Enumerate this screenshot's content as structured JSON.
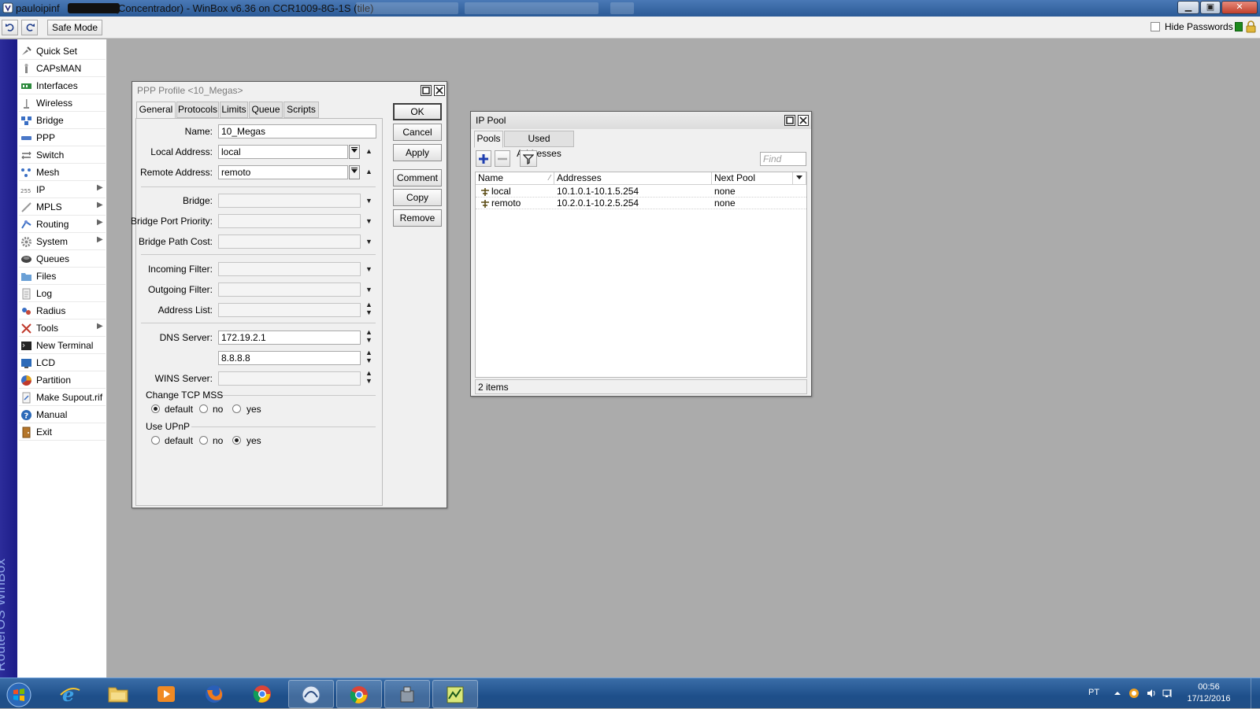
{
  "window": {
    "title_user": "pauloipinf",
    "title_rest": "(Concentrador) - WinBox v6.36 on CCR1009-8G-1S (tile)",
    "controls": {
      "minimize": "▁",
      "maximize": "▣",
      "close": "✕"
    }
  },
  "toolbar": {
    "undo_icon": "undo-icon",
    "redo_icon": "redo-icon",
    "safe_mode_label": "Safe Mode",
    "hide_passwords_label": "Hide Passwords",
    "hide_passwords_checked": false,
    "status_color": "#1d8a1d"
  },
  "branding": {
    "vertical_text": "RouterOS WinBox"
  },
  "sidebar": {
    "items": [
      {
        "label": "Quick Set",
        "icon": "quickset-icon",
        "submenu": false
      },
      {
        "label": "CAPsMAN",
        "icon": "capsman-icon",
        "submenu": false
      },
      {
        "label": "Interfaces",
        "icon": "interfaces-icon",
        "submenu": false
      },
      {
        "label": "Wireless",
        "icon": "wireless-icon",
        "submenu": false
      },
      {
        "label": "Bridge",
        "icon": "bridge-icon",
        "submenu": false
      },
      {
        "label": "PPP",
        "icon": "ppp-icon",
        "submenu": false
      },
      {
        "label": "Switch",
        "icon": "switch-icon",
        "submenu": false
      },
      {
        "label": "Mesh",
        "icon": "mesh-icon",
        "submenu": false
      },
      {
        "label": "IP",
        "icon": "ip-icon",
        "submenu": true
      },
      {
        "label": "MPLS",
        "icon": "mpls-icon",
        "submenu": true
      },
      {
        "label": "Routing",
        "icon": "routing-icon",
        "submenu": true
      },
      {
        "label": "System",
        "icon": "system-icon",
        "submenu": true
      },
      {
        "label": "Queues",
        "icon": "queues-icon",
        "submenu": false
      },
      {
        "label": "Files",
        "icon": "files-icon",
        "submenu": false
      },
      {
        "label": "Log",
        "icon": "log-icon",
        "submenu": false
      },
      {
        "label": "Radius",
        "icon": "radius-icon",
        "submenu": false
      },
      {
        "label": "Tools",
        "icon": "tools-icon",
        "submenu": true
      },
      {
        "label": "New Terminal",
        "icon": "terminal-icon",
        "submenu": false
      },
      {
        "label": "LCD",
        "icon": "lcd-icon",
        "submenu": false
      },
      {
        "label": "Partition",
        "icon": "partition-icon",
        "submenu": false
      },
      {
        "label": "Make Supout.rif",
        "icon": "supout-icon",
        "submenu": false
      },
      {
        "label": "Manual",
        "icon": "manual-icon",
        "submenu": false
      },
      {
        "label": "Exit",
        "icon": "exit-icon",
        "submenu": false
      }
    ],
    "submenu_arrow": "▶"
  },
  "ppp_profile": {
    "title": "PPP Profile <10_Megas>",
    "tabs": [
      "General",
      "Protocols",
      "Limits",
      "Queue",
      "Scripts"
    ],
    "active_tab": "General",
    "fields": {
      "name": {
        "label": "Name:",
        "value": "10_Megas"
      },
      "local_address": {
        "label": "Local Address:",
        "value": "local"
      },
      "remote_address": {
        "label": "Remote Address:",
        "value": "remoto"
      },
      "bridge": {
        "label": "Bridge:",
        "value": ""
      },
      "bridge_port_priority": {
        "label": "Bridge Port Priority:",
        "value": ""
      },
      "bridge_path_cost": {
        "label": "Bridge Path Cost:",
        "value": ""
      },
      "incoming_filter": {
        "label": "Incoming Filter:",
        "value": ""
      },
      "outgoing_filter": {
        "label": "Outgoing Filter:",
        "value": ""
      },
      "address_list": {
        "label": "Address List:",
        "value": ""
      },
      "dns_server": {
        "label": "DNS Server:",
        "value": "172.19.2.1"
      },
      "dns_server_2": {
        "value": "8.8.8.8"
      },
      "wins_server": {
        "label": "WINS Server:",
        "value": ""
      }
    },
    "change_tcp_mss": {
      "label": "Change TCP MSS",
      "options": [
        "default",
        "no",
        "yes"
      ],
      "selected": "default"
    },
    "use_upnp": {
      "label": "Use UPnP",
      "options": [
        "default",
        "no",
        "yes"
      ],
      "selected": "yes"
    },
    "buttons": {
      "ok": "OK",
      "cancel": "Cancel",
      "apply": "Apply",
      "comment": "Comment",
      "copy": "Copy",
      "remove": "Remove"
    }
  },
  "ip_pool": {
    "title": "IP Pool",
    "tabs": [
      "Pools",
      "Used Addresses"
    ],
    "active_tab": "Pools",
    "toolbar": {
      "add_icon": "plus-icon",
      "remove_icon": "minus-icon",
      "filter_icon": "filter-icon"
    },
    "find_placeholder": "Find",
    "columns": [
      "Name",
      "Addresses",
      "Next Pool"
    ],
    "rows": [
      {
        "name": "local",
        "addresses": "10.1.0.1-10.1.5.254",
        "next_pool": "none"
      },
      {
        "name": "remoto",
        "addresses": "10.2.0.1-10.2.5.254",
        "next_pool": "none"
      }
    ],
    "status": "2 items"
  },
  "taskbar": {
    "apps": [
      "start-orb",
      "internet-explorer",
      "file-explorer",
      "media-player",
      "firefox",
      "chrome",
      "winbox",
      "chrome",
      "network-tool",
      "task-manager"
    ],
    "language": "PT",
    "time": "00:56",
    "date": "17/12/2016"
  }
}
